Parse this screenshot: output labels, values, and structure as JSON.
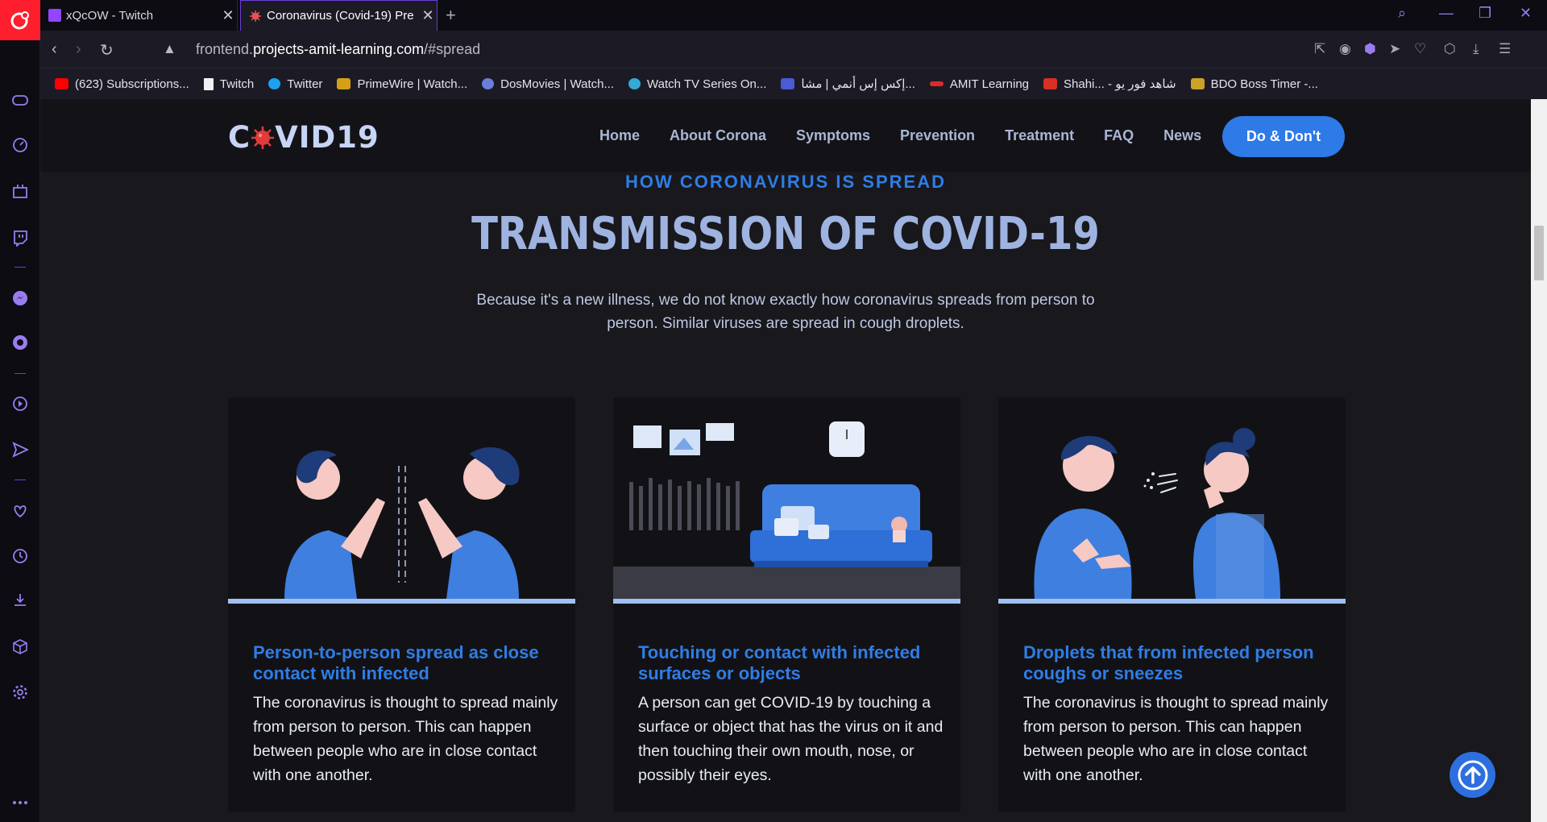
{
  "browser": {
    "tabs": [
      {
        "title": "xQcOW - Twitch",
        "favicon": "twitch-icon",
        "active": false
      },
      {
        "title": "Coronavirus (Covid-19) Pre",
        "favicon": "virus-icon",
        "active": true
      }
    ],
    "address": {
      "prefix": "frontend.",
      "domain": "projects-amit-learning.com",
      "suffix": "/#spread"
    },
    "bookmarks": [
      {
        "label": "(623) Subscriptions...",
        "icon": "youtube-icon",
        "color": "#ff0000"
      },
      {
        "label": "Twitch",
        "icon": "page-icon",
        "color": "#ffffff"
      },
      {
        "label": "Twitter",
        "icon": "twitter-icon",
        "color": "#1da1f2"
      },
      {
        "label": "PrimeWire | Watch...",
        "icon": "primewire-icon",
        "color": "#d4a017"
      },
      {
        "label": "DosMovies | Watch...",
        "icon": "dosmovies-icon",
        "color": "#6a7fdb"
      },
      {
        "label": "Watch TV Series On...",
        "icon": "tvseries-icon",
        "color": "#35a9d6"
      },
      {
        "label": "إكس إس أنمي | مشا...",
        "icon": "xs-icon",
        "color": "#4a5bd6"
      },
      {
        "label": "AMIT Learning",
        "icon": "amit-icon",
        "color": "#e02a2a"
      },
      {
        "label": "Shahi... - شاهد فور يو",
        "icon": "shahid-icon",
        "color": "#d93025"
      },
      {
        "label": "BDO Boss Timer -...",
        "icon": "bdo-icon",
        "color": "#c9a227"
      }
    ]
  },
  "site": {
    "logo_left": "C",
    "logo_right": "VID19",
    "nav": [
      "Home",
      "About Corona",
      "Symptoms",
      "Prevention",
      "Treatment",
      "FAQ",
      "News"
    ],
    "cta": "Do & Don't",
    "eyebrow": "HOW CORONAVIRUS IS SPREAD",
    "headline": "TRANSMISSION OF COVID-19",
    "lead": "Because it's a new illness, we do not know exactly how coronavirus spreads from person to person. Similar viruses are spread in cough droplets.",
    "cards": [
      {
        "title": "Person-to-person spread as close contact with infected",
        "body": "The coronavirus is thought to spread mainly from person to person. This can happen between people who are in close contact with one another."
      },
      {
        "title": "Touching or contact with infected surfaces or objects",
        "body": "A person can get COVID-19 by touching a surface or object that has the virus on it and then touching their own mouth, nose, or possibly their eyes."
      },
      {
        "title": "Droplets that from infected person coughs or sneezes",
        "body": "The coronavirus is thought to spread mainly from person to person. This can happen between people who are in close contact with one another."
      }
    ]
  },
  "colors": {
    "accent": "#2f7de6",
    "opera_red": "#ff1e2d",
    "gx_purple": "#6c3fd6"
  }
}
